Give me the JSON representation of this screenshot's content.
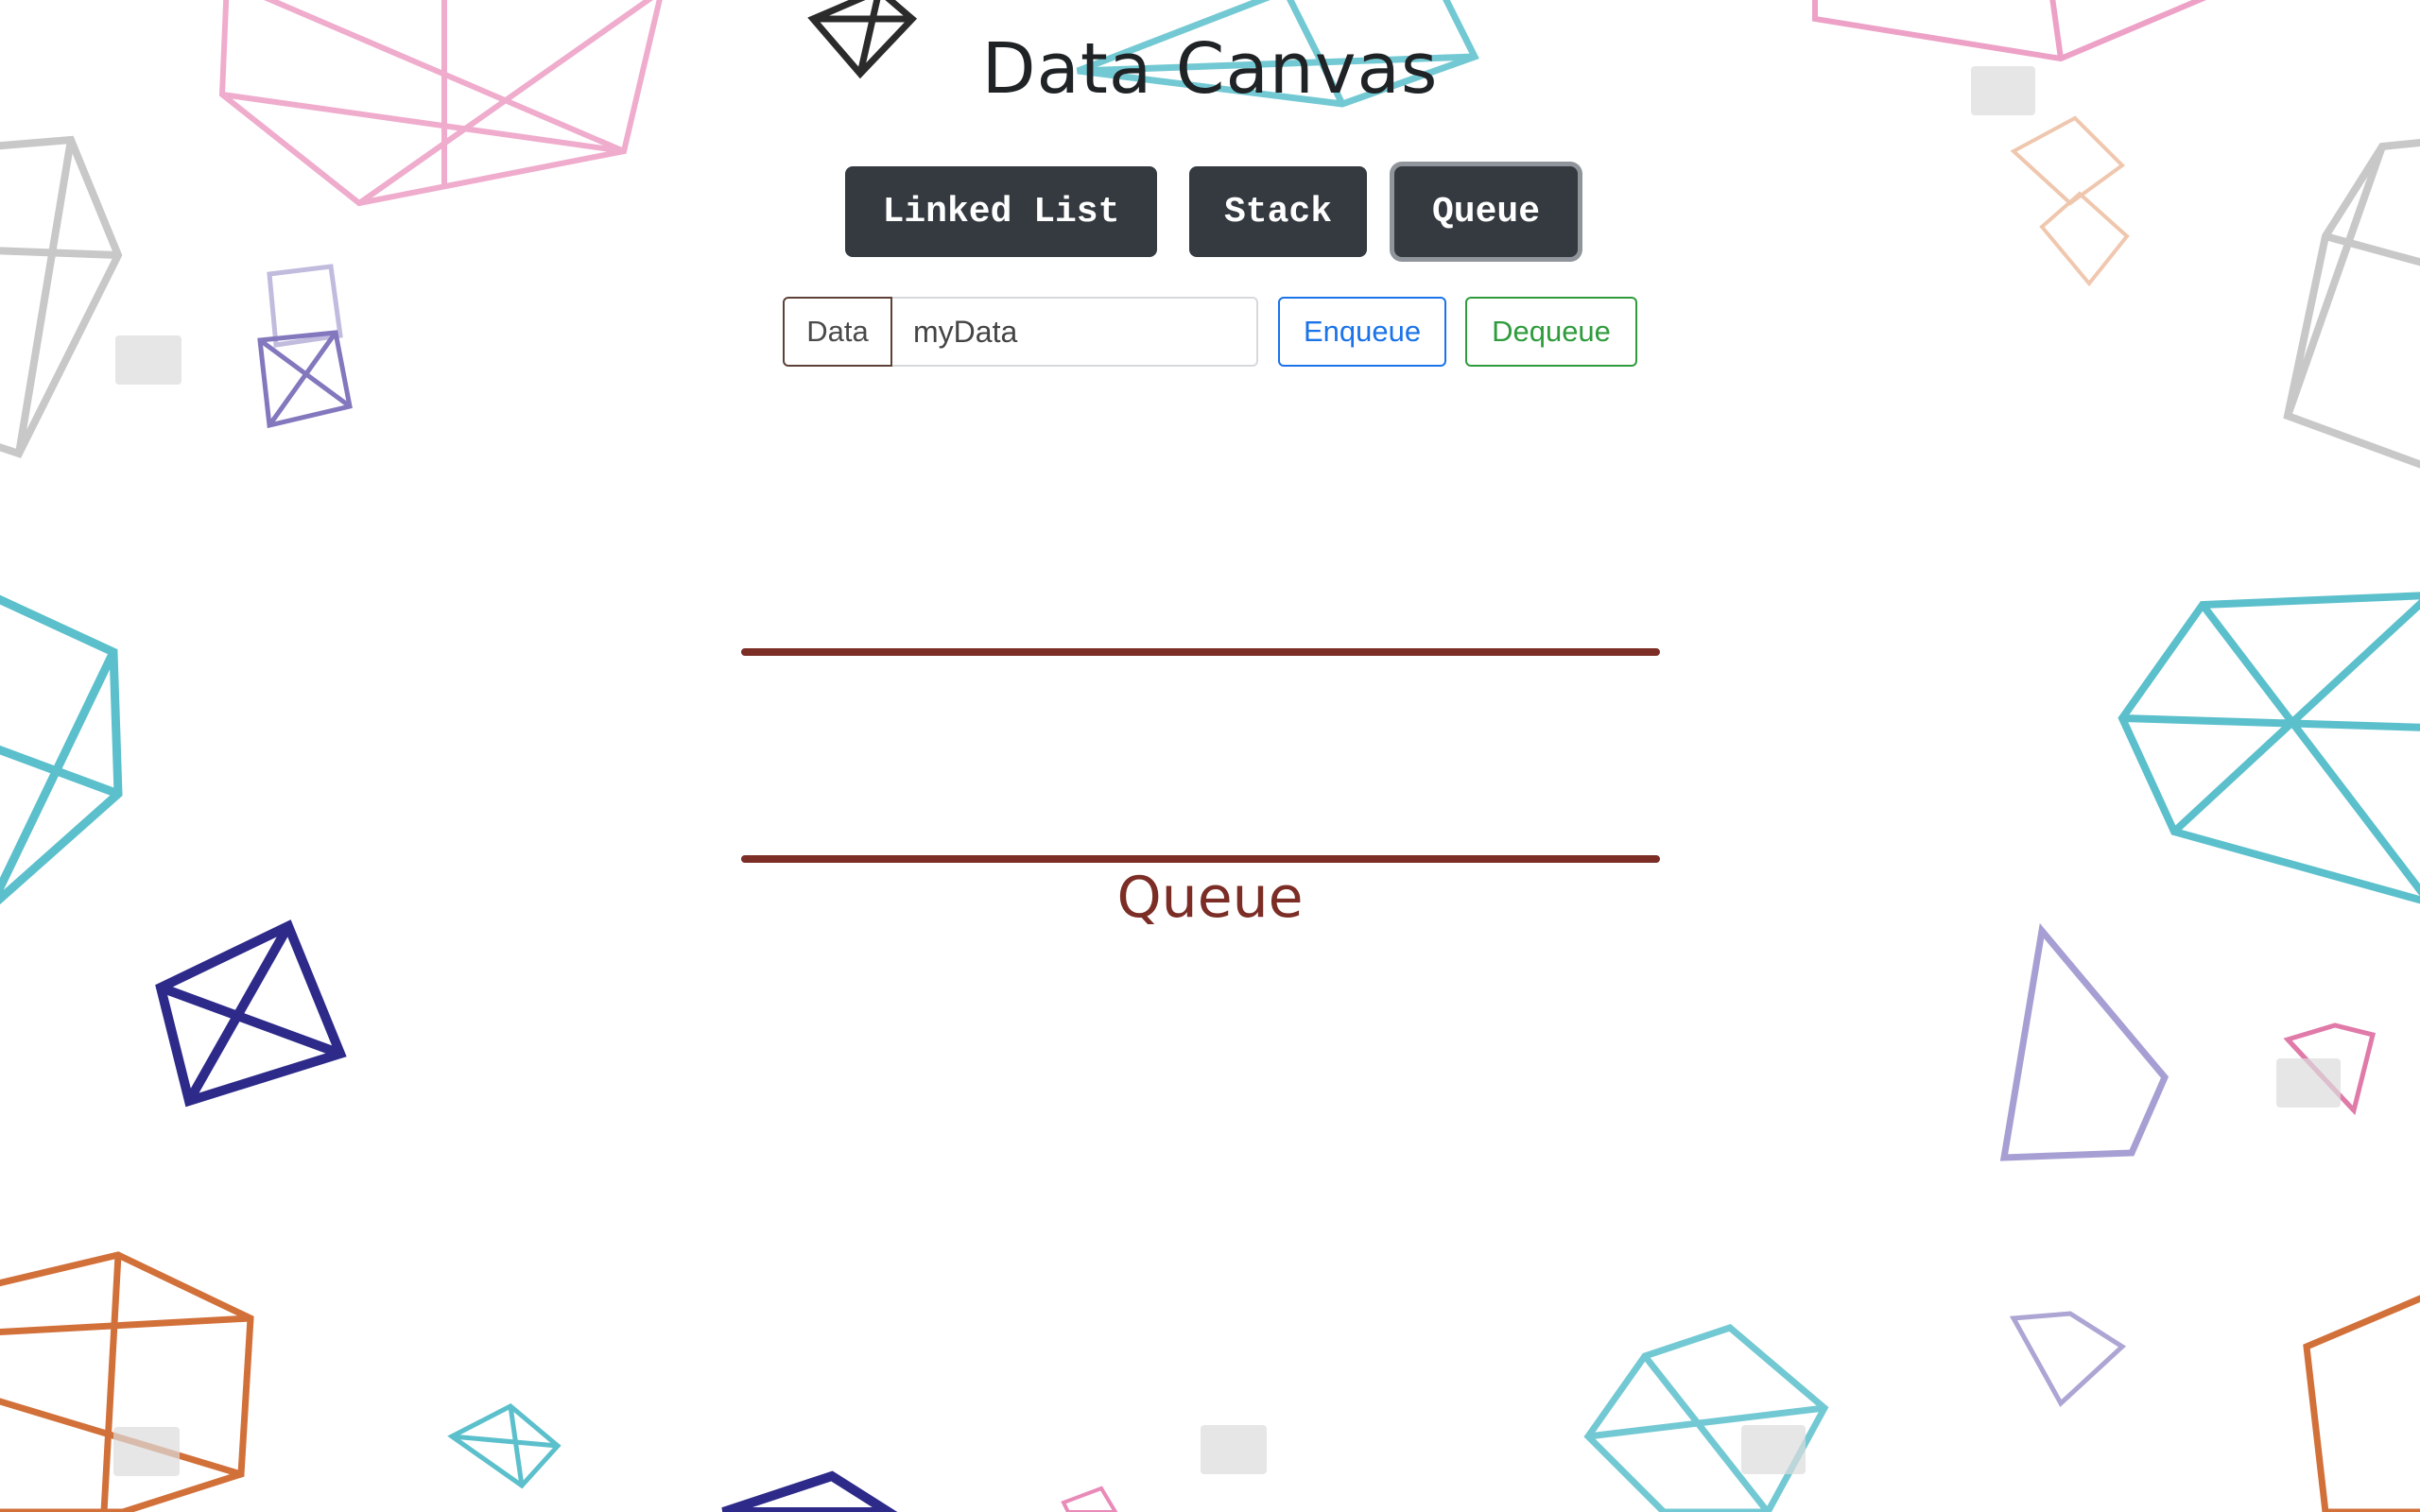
{
  "header": {
    "title": "Data Canvas"
  },
  "structures": [
    {
      "label": "Linked List",
      "active": false
    },
    {
      "label": "Stack",
      "active": false
    },
    {
      "label": "Queue",
      "active": true
    }
  ],
  "controls": {
    "data_label": "Data",
    "data_value": "myData",
    "enqueue_label": "Enqueue",
    "dequeue_label": "Dequeue"
  },
  "canvas": {
    "structure_label": "Queue",
    "items": []
  },
  "colors": {
    "structure_button_bg": "#343a40",
    "accent": "#7b2d26",
    "enqueue": "#1a73e8",
    "dequeue": "#2e9c3c"
  }
}
